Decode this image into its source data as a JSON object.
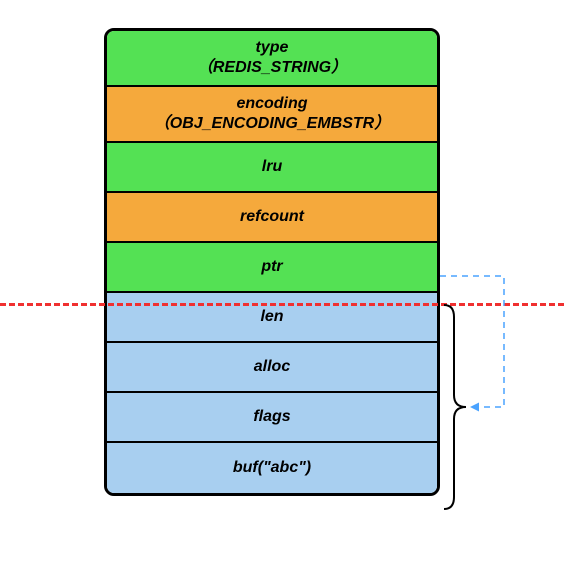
{
  "diagram": {
    "rows": [
      {
        "label": "type",
        "sub": "（REDIS_STRING）",
        "color": "green",
        "h": "tall"
      },
      {
        "label": "encoding",
        "sub": "（OBJ_ENCODING_EMBSTR）",
        "color": "orange",
        "h": "tall"
      },
      {
        "label": "lru",
        "sub": "",
        "color": "green",
        "h": "short"
      },
      {
        "label": "refcount",
        "sub": "",
        "color": "orange",
        "h": "short"
      },
      {
        "label": "ptr",
        "sub": "",
        "color": "green",
        "h": "short"
      },
      {
        "label": "len",
        "sub": "",
        "color": "blue",
        "h": "short"
      },
      {
        "label": "alloc",
        "sub": "",
        "color": "blue",
        "h": "short"
      },
      {
        "label": "flags",
        "sub": "",
        "color": "blue",
        "h": "short"
      },
      {
        "label": "buf(\"abc\")",
        "sub": "",
        "color": "blue",
        "h": "short"
      }
    ],
    "split_after_index": 4
  }
}
